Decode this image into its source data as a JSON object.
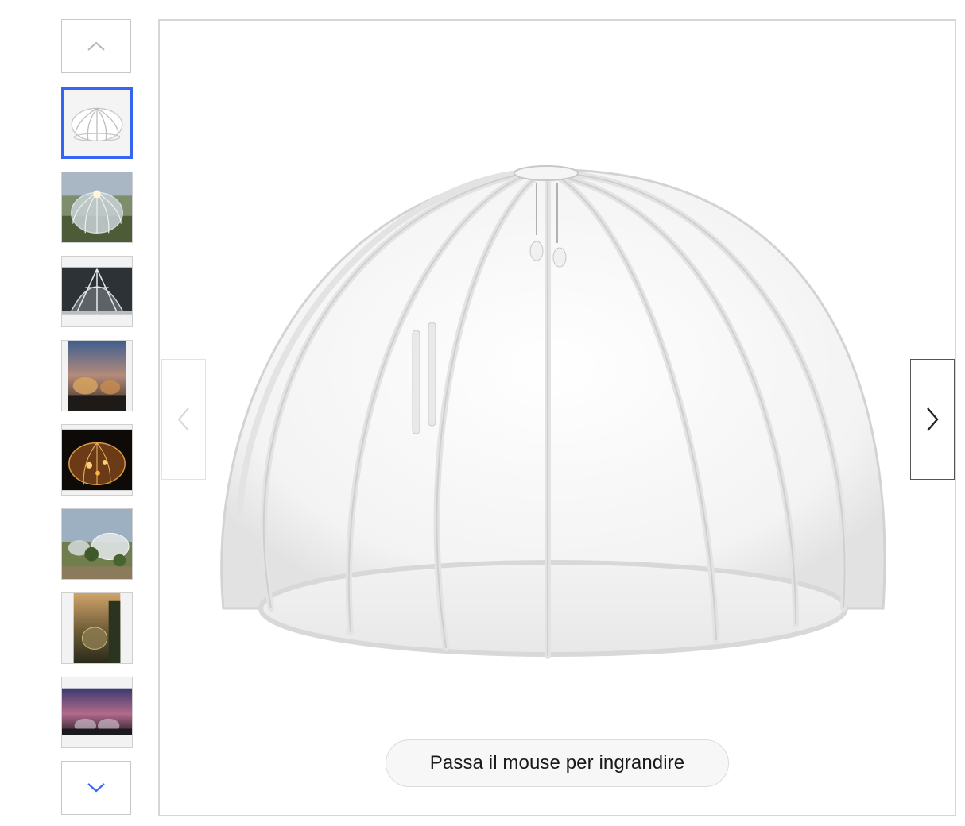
{
  "gallery": {
    "up_icon": "chevron-up-icon",
    "down_icon": "chevron-down-icon",
    "selected_index": 0,
    "accent_color": "#3665f3",
    "thumbnails": [
      {
        "name": "thumbnail-clear-dome"
      },
      {
        "name": "thumbnail-dome-garden"
      },
      {
        "name": "thumbnail-dome-dark-interior"
      },
      {
        "name": "thumbnail-dome-sunset-terrace"
      },
      {
        "name": "thumbnail-dome-night-lights"
      },
      {
        "name": "thumbnail-domes-garden-plants"
      },
      {
        "name": "thumbnail-dome-forest-dusk"
      },
      {
        "name": "thumbnail-domes-purple-sky"
      }
    ]
  },
  "viewer": {
    "prev_icon": "chevron-left-icon",
    "next_icon": "chevron-right-icon",
    "zoom_hint": "Passa il mouse per ingrandire"
  }
}
